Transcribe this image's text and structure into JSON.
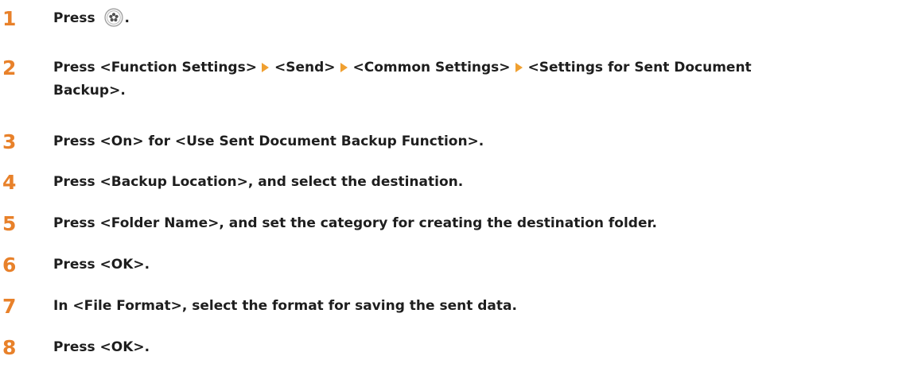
{
  "steps": [
    {
      "num": "1",
      "press": "Press",
      "icon": "home-button-icon",
      "after_icon": "."
    },
    {
      "num": "2",
      "parts": [
        "Press <Function Settings>",
        "<Send>",
        "<Common Settings>",
        "<Settings for Sent Document"
      ],
      "line2": "Backup>."
    },
    {
      "num": "3",
      "text": "Press <On> for <Use Sent Document Backup Function>."
    },
    {
      "num": "4",
      "text": "Press <Backup Location>, and select the destination."
    },
    {
      "num": "5",
      "text": "Press <Folder Name>, and set the category for creating the destination folder."
    },
    {
      "num": "6",
      "text": "Press <OK>."
    },
    {
      "num": "7",
      "text": "In <File Format>, select the format for saving the sent data."
    },
    {
      "num": "8",
      "text": "Press <OK>."
    }
  ],
  "colors": {
    "step_number": "#e8812a",
    "arrow": "#f0a030",
    "text": "#1e1e1e"
  }
}
